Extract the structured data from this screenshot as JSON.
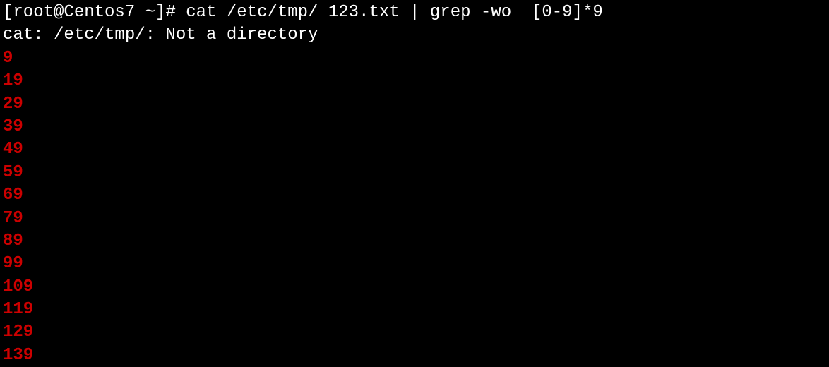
{
  "terminal": {
    "prompt": {
      "user_host": "[root@Centos7 ~]#",
      "command": " cat /etc/tmp/ 123.txt | grep -wo  [0-9]*9"
    },
    "error": "cat: /etc/tmp/: Not a directory",
    "matches": [
      "9",
      "19",
      "29",
      "39",
      "49",
      "59",
      "69",
      "79",
      "89",
      "99",
      "109",
      "119",
      "129",
      "139"
    ]
  }
}
